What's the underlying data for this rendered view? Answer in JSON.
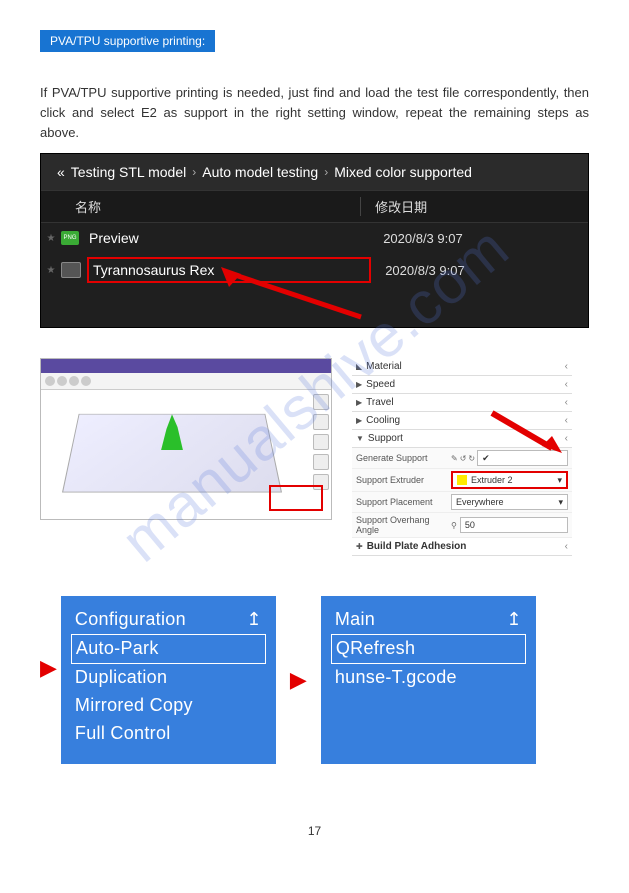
{
  "watermark": "manualshive.com",
  "section_title": "PVA/TPU supportive printing:",
  "paragraph": "If PVA/TPU supportive printing is needed, just find and load the test file correspondently, then click and select E2 as support in the right setting window, repeat the remaining steps as above.",
  "file_browser": {
    "breadcrumb": {
      "prefix": "«",
      "parts": [
        "Testing STL model",
        "Auto model testing",
        "Mixed color supported"
      ],
      "sep": "›"
    },
    "columns": {
      "name": "名称",
      "date": "修改日期"
    },
    "rows": [
      {
        "icon": "png",
        "name": "Preview",
        "date": "2020/8/3 9:07",
        "highlight": false
      },
      {
        "icon": "file",
        "name": "Tyrannosaurus Rex",
        "date": "2020/8/3 9:07",
        "highlight": true
      }
    ]
  },
  "slicer": {
    "sections": [
      {
        "label": "Material"
      },
      {
        "label": "Speed"
      },
      {
        "label": "Travel"
      },
      {
        "label": "Cooling"
      },
      {
        "label": "Support"
      }
    ],
    "props": [
      {
        "label": "Generate Support",
        "value": "",
        "icons": true,
        "check": true
      },
      {
        "label": "Support Extruder",
        "value": "Extruder 2",
        "highlight": true,
        "swatch": true
      },
      {
        "label": "Support Placement",
        "value": "Everywhere"
      },
      {
        "label": "Support Overhang Angle",
        "value": "50"
      }
    ],
    "footer": {
      "label": "Build Plate Adhesion"
    }
  },
  "menus": {
    "left": {
      "header": {
        "label": "Configuration",
        "icon": "↥"
      },
      "items": [
        "Auto-Park",
        "Duplication",
        "Mirrored Copy",
        "Full Control"
      ],
      "selected": 0
    },
    "right": {
      "header": {
        "label": "Main",
        "icon": "↥"
      },
      "items": [
        "QRefresh",
        "hunse-T.gcode"
      ],
      "selected": 0
    }
  },
  "page_number": "17"
}
